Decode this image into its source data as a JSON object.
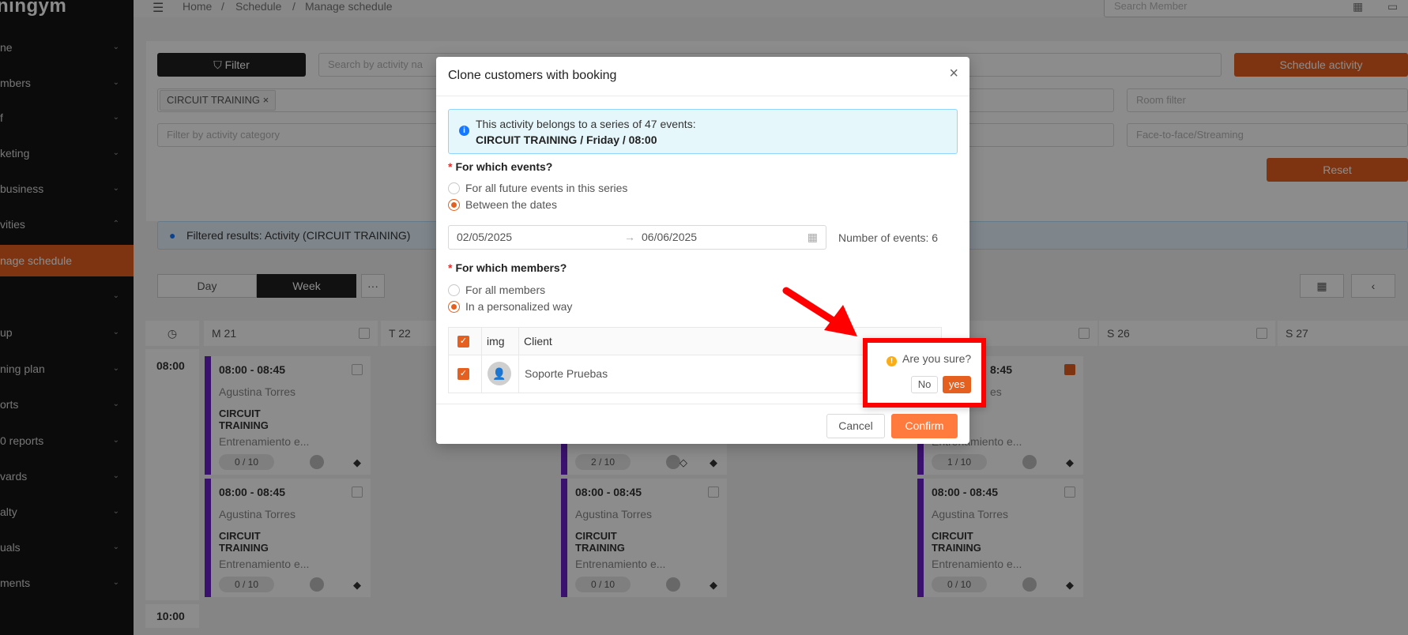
{
  "sidebar": {
    "logo": "ningym",
    "items": [
      {
        "label": "ne",
        "chevron": "down"
      },
      {
        "label": "mbers",
        "chevron": "down"
      },
      {
        "label": "f",
        "chevron": "down"
      },
      {
        "label": "keting",
        "chevron": "down"
      },
      {
        "label": "business",
        "chevron": "down"
      },
      {
        "label": "vities",
        "chevron": "up"
      },
      {
        "label": "nage schedule",
        "chevron": ""
      },
      {
        "label": "",
        "chevron": "down"
      },
      {
        "label": "up",
        "chevron": "down"
      },
      {
        "label": "ning plan",
        "chevron": "down"
      },
      {
        "label": "orts",
        "chevron": "down"
      },
      {
        "label": "0 reports",
        "chevron": "down"
      },
      {
        "label": "vards",
        "chevron": "down"
      },
      {
        "label": "alty",
        "chevron": "down"
      },
      {
        "label": "uals",
        "chevron": "down"
      },
      {
        "label": "ments",
        "chevron": "down"
      }
    ]
  },
  "topbar": {
    "breadcrumbs": [
      "Home",
      "Schedule",
      "Manage schedule"
    ],
    "search_member_placeholder": "Search Member"
  },
  "toolbar": {
    "filter_label": "Filter",
    "search_activity_placeholder": "Search by activity na",
    "schedule_activity_label": "Schedule activity",
    "activity_tag": "CIRCUIT TRAINING",
    "room_filter_placeholder": "Room filter",
    "category_placeholder": "Filter by activity category",
    "mode_placeholder": "Face-to-face/Streaming",
    "reset_label": "Reset",
    "filtered_results": "Filtered results: Activity (CIRCUIT TRAINING)",
    "view_day": "Day",
    "view_week": "Week",
    "more": "···"
  },
  "calendar": {
    "days": [
      {
        "label": "M 21"
      },
      {
        "label": "T 22"
      },
      {
        "label": "S 26"
      },
      {
        "label": "S 27"
      }
    ],
    "time_slots": [
      "08:00",
      "10:00"
    ],
    "event": {
      "time": "08:00 - 08:45",
      "trainer": "Agustina Torres",
      "name": "CIRCUIT TRAINING",
      "desc": "Entrenamiento e...",
      "partial_time": "8:45",
      "partial_trainer": "es"
    },
    "capacities": {
      "mon_1": "0 / 10",
      "mon_2": "0 / 10",
      "wed_1": "2 / 10",
      "wed_2": "0 / 10",
      "fri_1": "1 / 10",
      "fri_2": "0 / 10"
    }
  },
  "modal": {
    "title": "Clone customers with booking",
    "info_line1": "This activity belongs to a series of 47 events:",
    "info_line2": "CIRCUIT TRAINING / Friday / 08:00",
    "events_question": "For which events?",
    "events_opt1": "For all future events in this series",
    "events_opt2": "Between the dates",
    "date_start": "02/05/2025",
    "date_end": "06/06/2025",
    "number_of_events": "Number of events: 6",
    "members_question": "For which members?",
    "members_opt1": "For all members",
    "members_opt2": "In a personalized way",
    "table": {
      "col_img": "img",
      "col_client": "Client",
      "rows": [
        {
          "client": "Soporte Pruebas"
        }
      ]
    },
    "cancel_label": "Cancel",
    "confirm_label": "Confirm"
  },
  "popconfirm": {
    "question": "Are you sure?",
    "no_label": "No",
    "yes_label": "yes"
  },
  "colors": {
    "accent": "#e5601f",
    "event_bar": "#6a1fc9",
    "highlight": "#ff0000"
  }
}
